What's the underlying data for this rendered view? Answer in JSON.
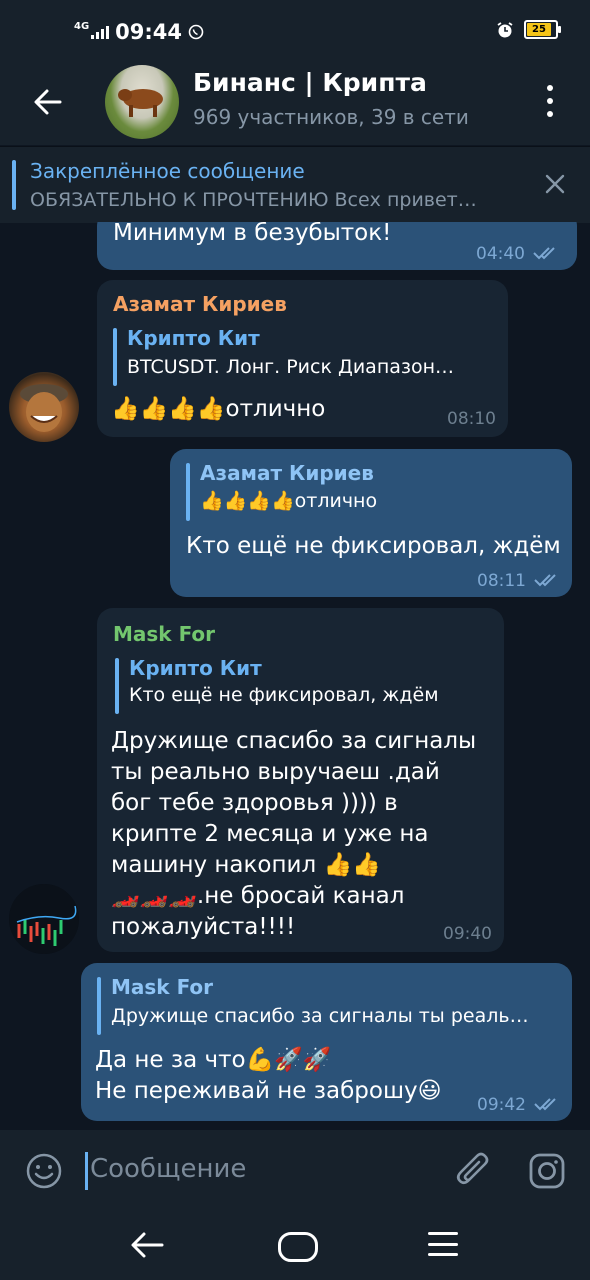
{
  "status_bar": {
    "network": "4G",
    "time": "09:44",
    "battery": "25"
  },
  "header": {
    "title": "Бинанс | Крипта",
    "subtitle": "969 участников, 39 в сети"
  },
  "pinned": {
    "title": "Закреплённое сообщение",
    "text": "ОБЯЗАТЕЛЬНО К ПРОЧТЕНИЮ  Всех привет…"
  },
  "messages": [
    {
      "text": "Минимум в безубыток!",
      "time": "04:40"
    },
    {
      "sender": "Азамат Кириев",
      "reply_name": "Крипто Кит",
      "reply_text": "BTCUSDT. Лонг. Риск   Диапазон…",
      "text": "👍👍👍👍отлично",
      "time": "08:10"
    },
    {
      "reply_name": "Азамат Кириев",
      "reply_text": "👍👍👍👍отлично",
      "text": "Кто ещё не фиксировал, ждём",
      "time": "08:11"
    },
    {
      "sender": "Mask For",
      "reply_name": "Крипто Кит",
      "reply_text": "Кто ещё не фиксировал, ждём",
      "lines": [
        "Дружище спасибо за сигналы",
        "ты реально выручаеш  .дай",
        "бог тебе здоровья )))) в",
        "крипте 2 месяца и уже на",
        "машину накопил 👍👍",
        "🏎️🏎️🏎️.не бросай канал",
        "пожалуйста!!!!"
      ],
      "time": "09:40"
    },
    {
      "reply_name": "Mask For",
      "reply_text": "Дружище спасибо за сигналы ты реаль…",
      "lines": [
        "Да не за что💪🚀🚀",
        "Не переживай не заброшу😃"
      ],
      "time": "09:42"
    }
  ],
  "input": {
    "placeholder": "Сообщение"
  },
  "colors": {
    "background": "#0e1621",
    "bar": "#17212b",
    "incoming": "#182533",
    "outgoing": "#2b5278",
    "accent": "#6ab2f2",
    "sender_orange": "#f5a162",
    "sender_green": "#73c66e"
  }
}
